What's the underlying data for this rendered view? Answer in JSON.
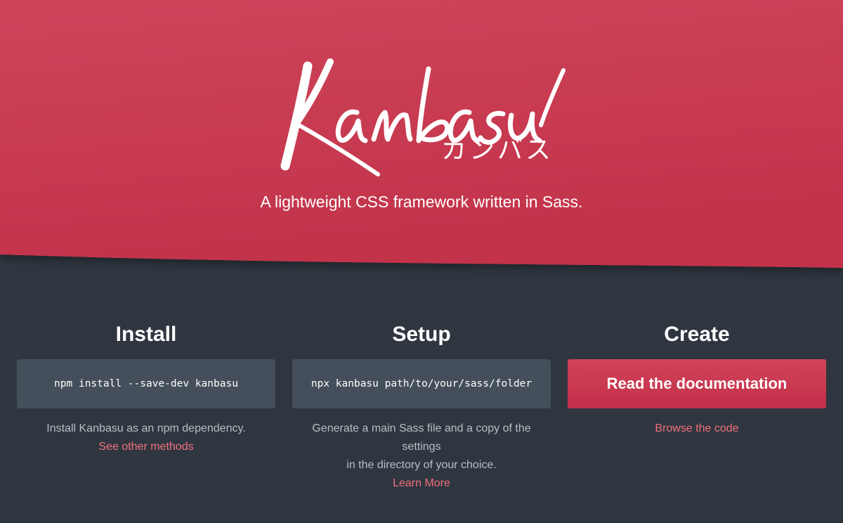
{
  "colors": {
    "brand_red": "#c73a50",
    "page_bg": "#2f3640",
    "code_bg": "#444f5b",
    "link": "#f2707b",
    "muted_text": "#b9bec4"
  },
  "hero": {
    "logo_text": "Kanbasu",
    "logo_kana": "カンバス",
    "tagline": "A lightweight CSS framework written in Sass."
  },
  "columns": {
    "install": {
      "title": "Install",
      "code": "npm install --save-dev kanbasu",
      "description": "Install Kanbasu as an npm dependency.",
      "link": "See other methods"
    },
    "setup": {
      "title": "Setup",
      "code": "npx kanbasu path/to/your/sass/folder",
      "description_line1": "Generate a main Sass file and a copy of the settings",
      "description_line2": "in the directory of your choice.",
      "link": "Learn More"
    },
    "create": {
      "title": "Create",
      "button": "Read the documentation",
      "link": "Browse the code"
    }
  }
}
